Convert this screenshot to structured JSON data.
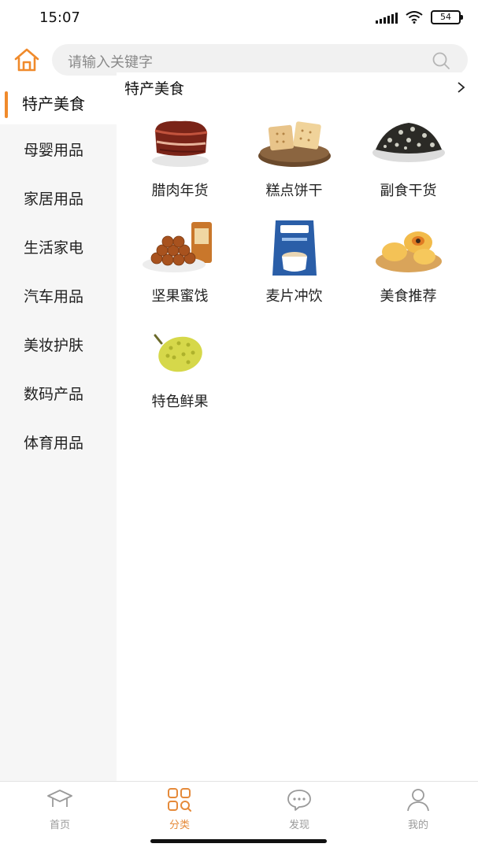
{
  "status_bar": {
    "time": "15:07",
    "battery": "54"
  },
  "search": {
    "placeholder": "请输入关键字"
  },
  "sidebar": {
    "items": [
      {
        "label": "特产美食",
        "active": true
      },
      {
        "label": "母婴用品"
      },
      {
        "label": "家居用品"
      },
      {
        "label": "生活家电"
      },
      {
        "label": "汽车用品"
      },
      {
        "label": "美妆护肤"
      },
      {
        "label": "数码产品"
      },
      {
        "label": "体育用品"
      }
    ]
  },
  "content": {
    "title": "特产美食",
    "items": [
      {
        "label": "腊肉年货",
        "icon": "cured-meat-image"
      },
      {
        "label": "糕点饼干",
        "icon": "biscuits-image"
      },
      {
        "label": "副食干货",
        "icon": "dried-food-image"
      },
      {
        "label": "坚果蜜饯",
        "icon": "nuts-image"
      },
      {
        "label": "麦片冲饮",
        "icon": "cereal-drink-image"
      },
      {
        "label": "美食推荐",
        "icon": "pastry-image"
      },
      {
        "label": "特色鲜果",
        "icon": "durian-image"
      }
    ]
  },
  "tabbar": {
    "tabs": [
      {
        "label": "首页",
        "icon": "home-cap-icon"
      },
      {
        "label": "分类",
        "icon": "category-grid-icon",
        "active": true
      },
      {
        "label": "发现",
        "icon": "chat-bubble-icon"
      },
      {
        "label": "我的",
        "icon": "user-icon"
      }
    ]
  },
  "colors": {
    "accent": "#f08a2b",
    "tab_active": "#e58a3a",
    "sidebar_bg": "#f6f6f6"
  }
}
